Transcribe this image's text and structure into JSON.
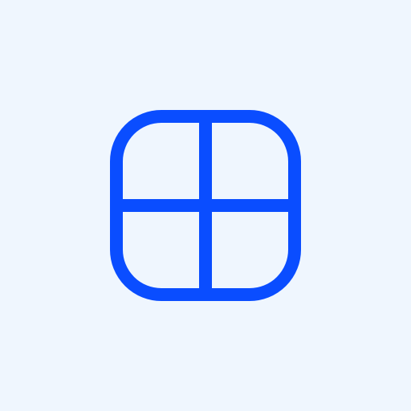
{
  "icon": {
    "name": "grid-icon",
    "shape": "rounded-square-with-2x2-grid"
  },
  "colors": {
    "background": "#eff6fe",
    "stroke": "#0a4dff"
  }
}
